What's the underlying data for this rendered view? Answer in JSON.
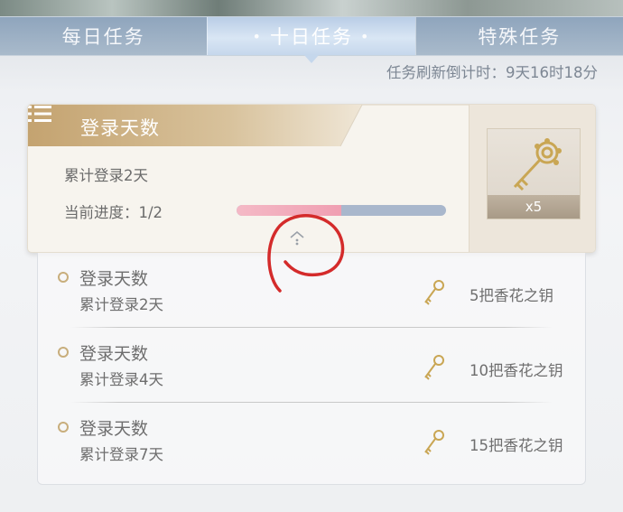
{
  "tabs": [
    {
      "label": "每日任务"
    },
    {
      "label": "十日任务"
    },
    {
      "label": "特殊任务"
    }
  ],
  "refresh_countdown": "任务刷新倒计时：9天16时18分",
  "active_task": {
    "title": "登录天数",
    "description": "累计登录2天",
    "progress_label": "当前进度：1/2",
    "progress_fraction": 0.5,
    "reward_icon": "key-icon",
    "reward_count": "x5"
  },
  "task_list": [
    {
      "title": "登录天数",
      "description": "累计登录2天",
      "reward": "5把香花之钥"
    },
    {
      "title": "登录天数",
      "description": "累计登录4天",
      "reward": "10把香花之钥"
    },
    {
      "title": "登录天数",
      "description": "累计登录7天",
      "reward": "15把香花之钥"
    }
  ],
  "colors": {
    "accent_gold": "#c8a96e",
    "tab_bg": "#9fb2c7",
    "progress_fill": "#f09fb2",
    "progress_track": "#a9b7cc",
    "annotation_red": "#d42b2b"
  }
}
